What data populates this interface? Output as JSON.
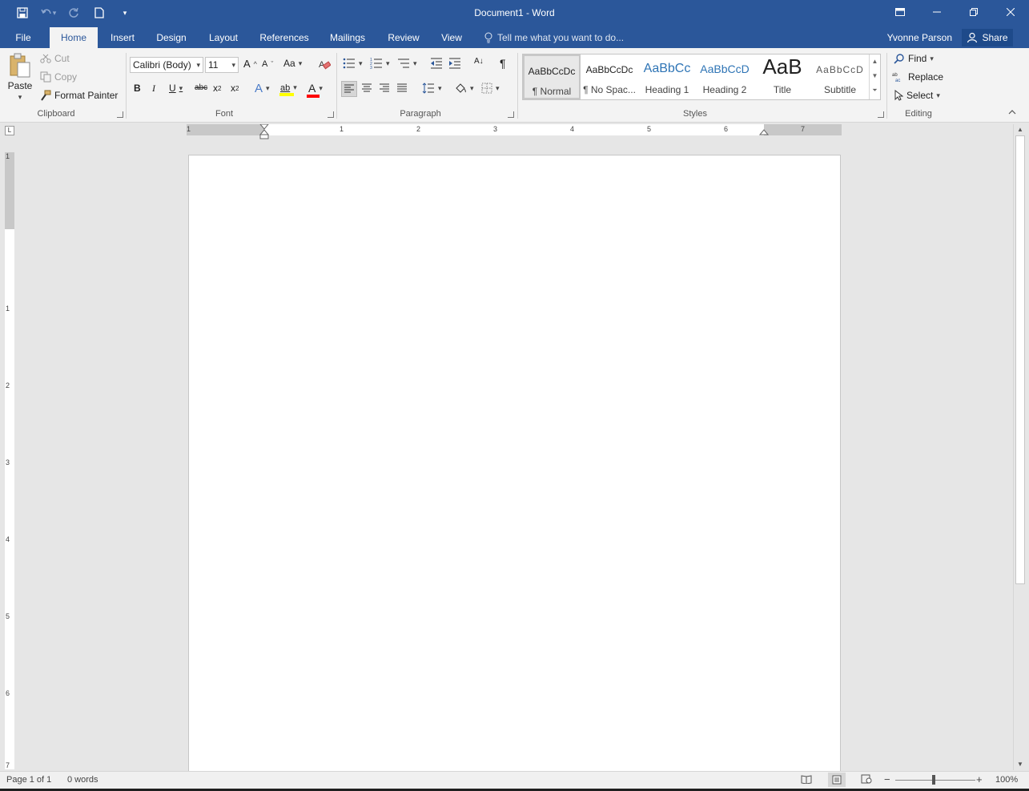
{
  "window": {
    "title": "Document1 - Word",
    "controls": {
      "ribbon_display": "⊡",
      "minimize": "—",
      "restore": "❐",
      "close": "✕"
    }
  },
  "qat": {
    "save": "💾",
    "undo": "↶",
    "undo_dd": "▾",
    "redo": "↻",
    "new": "🗋",
    "customize": "▾"
  },
  "tabs": [
    "File",
    "Home",
    "Insert",
    "Design",
    "Layout",
    "References",
    "Mailings",
    "Review",
    "View"
  ],
  "tell_me": "Tell me what you want to do...",
  "user": {
    "name": "Yvonne Parson"
  },
  "share_label": "Share",
  "ribbon": {
    "clipboard": {
      "group_label": "Clipboard",
      "paste": "Paste",
      "cut": "Cut",
      "copy": "Copy",
      "format_painter": "Format Painter"
    },
    "font": {
      "group_label": "Font",
      "font_name": "Calibri (Body)",
      "font_size": "11",
      "grow": "A",
      "shrink": "A",
      "change_case": "Aa",
      "bold": "B",
      "italic": "I",
      "underline": "U",
      "strikethrough": "abc",
      "subscript": "x",
      "subscript_mark": "2",
      "superscript": "x",
      "superscript_mark": "2",
      "text_effects": "A",
      "highlight": "ab",
      "font_color": "A"
    },
    "paragraph": {
      "group_label": "Paragraph",
      "show_marks": "¶",
      "sort": "A↓"
    },
    "styles": {
      "group_label": "Styles",
      "items": [
        {
          "preview": "AaBbCcDc",
          "name": "¶ Normal"
        },
        {
          "preview": "AaBbCcDc",
          "name": "¶ No Spac..."
        },
        {
          "preview": "AaBbCc",
          "name": "Heading 1"
        },
        {
          "preview": "AaBbCcD",
          "name": "Heading 2"
        },
        {
          "preview": "AaB",
          "name": "Title"
        },
        {
          "preview": "AaBbCcD",
          "name": "Subtitle"
        }
      ]
    },
    "editing": {
      "group_label": "Editing",
      "find": "Find",
      "replace": "Replace",
      "select": "Select"
    }
  },
  "rulers": {
    "horizontal_numbers": [
      "1",
      "1",
      "2",
      "3",
      "4",
      "5",
      "6",
      "7"
    ],
    "vertical_numbers": [
      "1",
      "1",
      "2",
      "3",
      "4",
      "5",
      "6",
      "7"
    ],
    "tab_selector": "L"
  },
  "statusbar": {
    "page": "Page 1 of 1",
    "words": "0 words",
    "zoom": "100%",
    "zoom_minus": "−",
    "zoom_plus": "+"
  },
  "colors": {
    "brand": "#2b579a",
    "ribbon": "#f3f3f3",
    "highlight_yellow": "#ffff00",
    "font_red": "#ff0000"
  }
}
